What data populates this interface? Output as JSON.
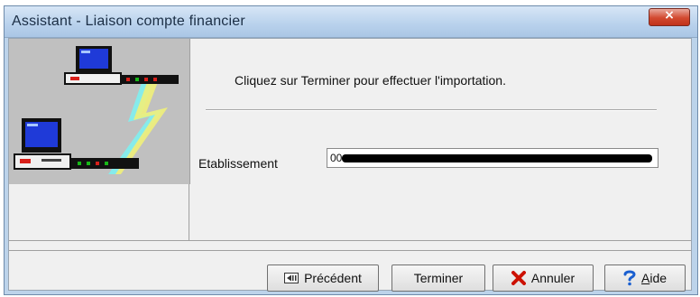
{
  "window": {
    "title": "Assistant - Liaison compte financier",
    "close_glyph": "×"
  },
  "main": {
    "instruction": "Cliquez sur Terminer pour effectuer l'importation.",
    "etablissement_label": "Etablissement",
    "etablissement_value": "00"
  },
  "footer": {
    "prev_label": "Précédent",
    "finish_label": "Terminer",
    "cancel_label": "Annuler",
    "help_label_first": "A",
    "help_label_rest": "ide"
  },
  "icons": {
    "illustration": "network-computers-illustration",
    "prev": "previous-arrow-icon",
    "cancel": "red-x-icon",
    "help": "question-mark-icon"
  },
  "colors": {
    "title_bar": "#b8d1ec",
    "close_button": "#d2492f",
    "client_bg": "#f0f0f0",
    "illustration_bg": "#c0c0c0",
    "cancel_icon": "#cc1100",
    "help_icon": "#1a5fd0"
  }
}
